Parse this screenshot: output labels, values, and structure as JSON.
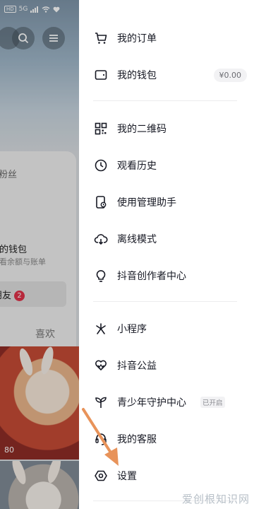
{
  "background_page": {
    "status_bar": {
      "labels": [
        "HD",
        "5G",
        "46"
      ]
    },
    "followers_label": "粉丝",
    "wallet": {
      "title": "我的钱包",
      "subtitle": "查看余额与账单"
    },
    "friends": {
      "label": "朋友",
      "count": "2"
    },
    "likes_tab": "喜欢",
    "video_play_count": "80"
  },
  "drawer": {
    "group1": [
      {
        "icon": "cart-icon",
        "label": "我的订单"
      },
      {
        "icon": "wallet-icon",
        "label": "我的钱包",
        "value": "¥0.00"
      }
    ],
    "group2": [
      {
        "icon": "qrcode-icon",
        "label": "我的二维码"
      },
      {
        "icon": "clock-icon",
        "label": "观看历史"
      },
      {
        "icon": "phone-manage-icon",
        "label": "使用管理助手"
      },
      {
        "icon": "cloud-download-icon",
        "label": "离线模式"
      },
      {
        "icon": "lightbulb-icon",
        "label": "抖音创作者中心"
      }
    ],
    "group3": [
      {
        "icon": "mini-program-icon",
        "label": "小程序"
      },
      {
        "icon": "heart-hands-icon",
        "label": "抖音公益"
      },
      {
        "icon": "sprout-icon",
        "label": "青少年守护中心",
        "tag": "已开启"
      },
      {
        "icon": "headset-icon",
        "label": "我的客服"
      },
      {
        "icon": "settings-hexagon-icon",
        "label": "设置"
      }
    ]
  },
  "watermark": "爱创根知识网",
  "colors": {
    "arrow": "#e8935a",
    "badge": "#e0334a",
    "text": "#161823"
  }
}
